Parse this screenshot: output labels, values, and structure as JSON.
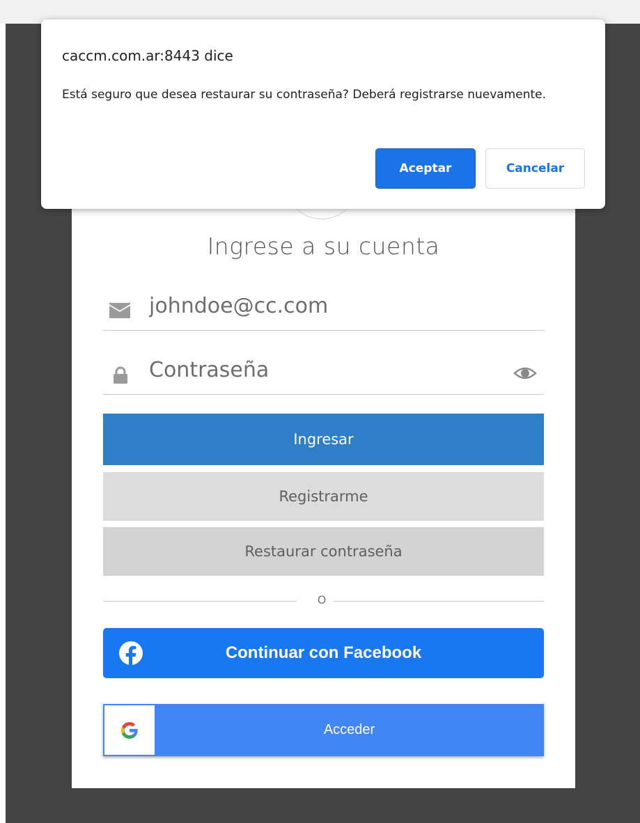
{
  "dialog": {
    "origin": "caccm.com.ar:8443 dice",
    "message": "Está seguro que desea restaurar su contraseña? Deberá registrarse nuevamente.",
    "accept_label": "Aceptar",
    "cancel_label": "Cancelar"
  },
  "login": {
    "title": "Ingrese a su cuenta",
    "email_placeholder": "johndoe@cc.com",
    "password_placeholder": "Contraseña",
    "submit_label": "Ingresar",
    "register_label": "Registrarme",
    "restore_label": "Restaurar contraseña",
    "divider_text": "O",
    "facebook_label": "Continuar con Facebook",
    "google_label": "Acceder"
  },
  "icons": {
    "email": "envelope-icon",
    "password": "lock-icon",
    "toggle_password": "eye-icon",
    "facebook": "facebook-icon",
    "google": "google-icon"
  },
  "colors": {
    "overlay": "#444444",
    "primary": "#2f7fc8",
    "facebook": "#1a77f2",
    "google": "#4285f4",
    "dialog_accent": "#1a73e8"
  }
}
